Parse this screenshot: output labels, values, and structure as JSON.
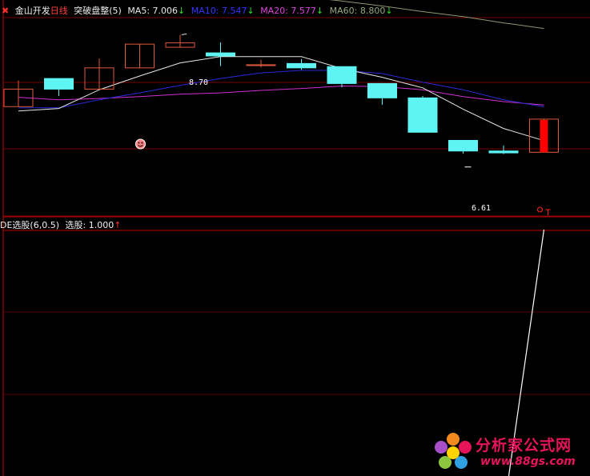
{
  "header": {
    "close_glyph": "✖",
    "stock": "金山开发",
    "period": "日线",
    "formula": "突破盘整(5)",
    "ma5": "MA5: 7.006",
    "ma5_arrow": "↓",
    "ma10": "MA10: 7.547",
    "ma10_arrow": "↓",
    "ma20": "MA20: 7.577",
    "ma20_arrow": "↓",
    "ma60": "MA60: 8.800",
    "ma60_arrow": "↓"
  },
  "indicator": {
    "name": "DE选股(6,0.5)",
    "value": "选股: 1.000",
    "arrow": "↑"
  },
  "annotations": {
    "high": "8.70",
    "low": "6.61"
  },
  "watermark": {
    "title": "分析家公式网",
    "url": "www.88gs.com"
  },
  "colors": {
    "up": "#e05a3a",
    "down": "#5ef4f4",
    "limit_up_fill": "#ff0000",
    "ma5": "#e8e8e8",
    "ma10": "#2a2ad8",
    "ma20": "#d030d0",
    "ma60": "#8a9a70",
    "grid": "#7a0000",
    "indicator_line": "#ffffff"
  },
  "chart_data": [
    {
      "type": "candlestick",
      "ylim": [
        5.8,
        9.0
      ],
      "candles": [
        {
          "open": 7.55,
          "close": 7.83,
          "high": 7.97,
          "low": 7.55
        },
        {
          "open": 8.0,
          "close": 7.83,
          "high": 8.0,
          "low": 7.72
        },
        {
          "open": 7.83,
          "close": 8.17,
          "high": 8.32,
          "low": 7.83
        },
        {
          "open": 8.17,
          "close": 8.55,
          "high": 8.55,
          "low": 8.17
        },
        {
          "open": 8.5,
          "close": 8.57,
          "high": 8.7,
          "low": 8.5
        },
        {
          "open": 8.41,
          "close": 8.36,
          "high": 8.58,
          "low": 8.2
        },
        {
          "open": 8.22,
          "close": 8.22,
          "high": 8.3,
          "low": 8.18
        },
        {
          "open": 8.24,
          "close": 8.17,
          "high": 8.31,
          "low": 8.14
        },
        {
          "open": 8.19,
          "close": 7.92,
          "high": 8.19,
          "low": 7.86
        },
        {
          "open": 7.92,
          "close": 7.69,
          "high": 7.92,
          "low": 7.58
        },
        {
          "open": 7.69,
          "close": 7.14,
          "high": 7.72,
          "low": 7.14
        },
        {
          "open": 7.01,
          "close": 6.84,
          "high": 7.01,
          "low": 6.8
        },
        {
          "open": 6.84,
          "close": 6.81,
          "high": 6.93,
          "low": 6.79
        },
        {
          "open": 6.82,
          "close": 7.35,
          "high": 7.35,
          "low": 6.82
        }
      ],
      "ma5": [
        7.48,
        7.52,
        7.82,
        8.04,
        8.25,
        8.35,
        8.35,
        8.35,
        8.16,
        8.02,
        7.85,
        7.51,
        7.2,
        7.006
      ],
      "ma10": [
        7.53,
        7.53,
        7.66,
        7.77,
        7.89,
        8.0,
        8.09,
        8.13,
        8.13,
        8.08,
        7.94,
        7.82,
        7.66,
        7.547
      ],
      "ma20": [
        7.7,
        7.66,
        7.68,
        7.71,
        7.75,
        7.77,
        7.81,
        7.84,
        7.88,
        7.87,
        7.82,
        7.71,
        7.63,
        7.577
      ],
      "ma60": [
        9.8,
        9.74,
        9.67,
        9.61,
        9.53,
        9.46,
        9.37,
        9.31,
        9.24,
        9.16,
        9.07,
        8.99,
        8.89,
        8.8
      ]
    },
    {
      "type": "line",
      "name": "选股",
      "ylim": [
        0,
        1
      ],
      "values": [
        0,
        0,
        0,
        0,
        0,
        0,
        0,
        0,
        0,
        0,
        0,
        0,
        0,
        1
      ]
    }
  ]
}
